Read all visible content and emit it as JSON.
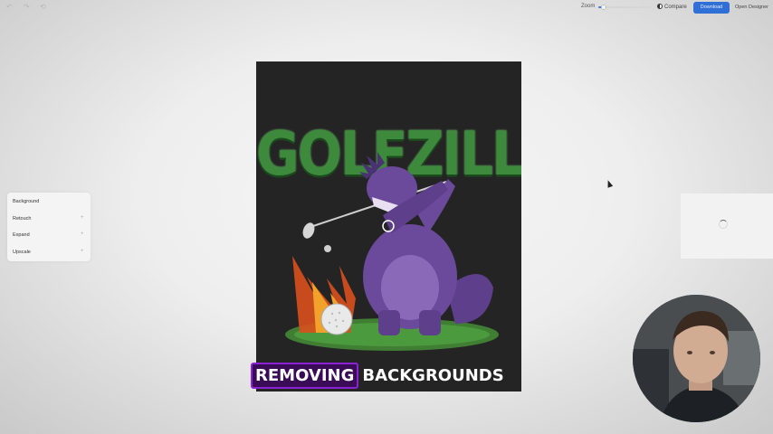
{
  "toolbar": {
    "zoom_label": "Zoom",
    "zoom_level": 0.1,
    "compare_label": "Compare",
    "download_label": "Download",
    "open_designer_label": "Open Designer",
    "icons": [
      "undo-icon",
      "redo-icon",
      "back-icon"
    ]
  },
  "tools_panel": {
    "items": [
      {
        "label": "Background"
      },
      {
        "label": "Retouch"
      },
      {
        "label": "Expand"
      },
      {
        "label": "Upscale"
      }
    ]
  },
  "artwork": {
    "title": "GOLFZILLA"
  },
  "caption": {
    "highlight": "REMOVING",
    "rest": "BACKGROUNDS"
  },
  "colors": {
    "accent": "#2f6fd6",
    "caption_highlight": "#8a22d8",
    "title_green": "#3d8a3c",
    "monster_purple": "#6b4a9c"
  }
}
